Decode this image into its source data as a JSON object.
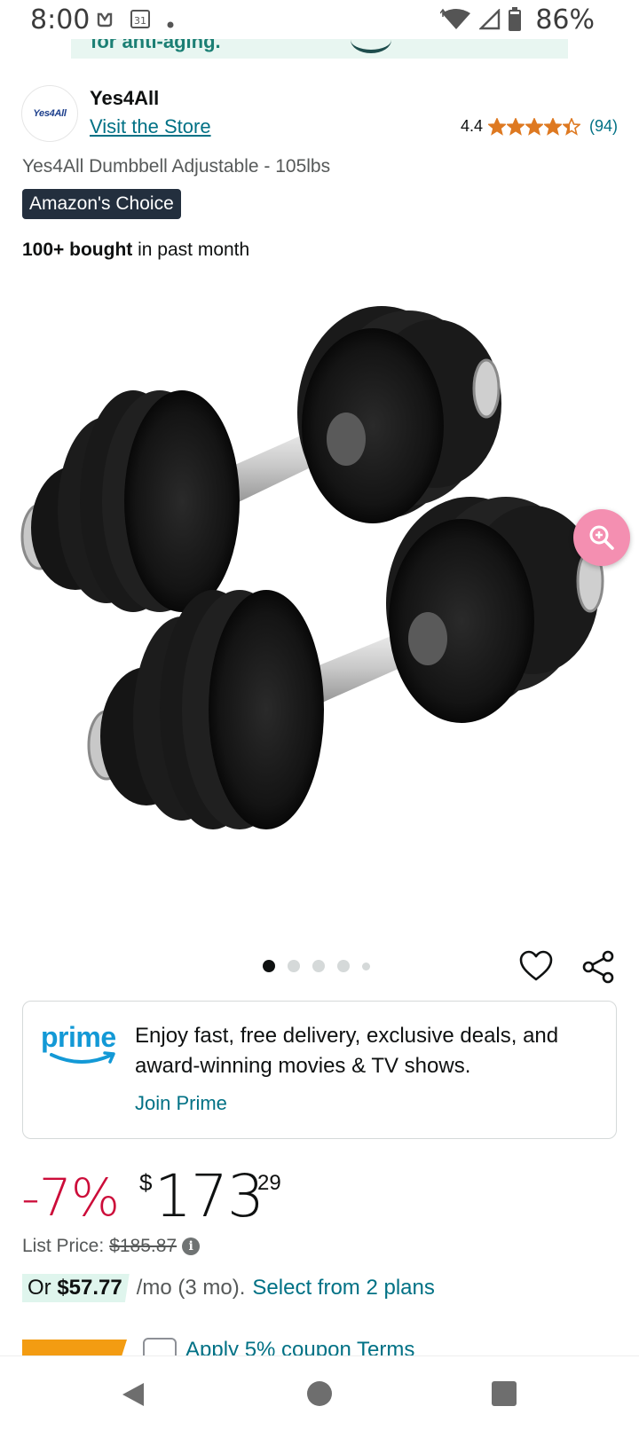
{
  "status_bar": {
    "time": "8:00",
    "calendar_day": "31",
    "battery": "86%"
  },
  "ad": {
    "text": "for anti-aging."
  },
  "seller": {
    "logo_text": "Yes4All",
    "name": "Yes4All",
    "store_link": "Visit the Store",
    "rating_value": "4.4",
    "rating_stars": 4.4,
    "rating_count": "(94)"
  },
  "product": {
    "title": "Yes4All Dumbbell Adjustable - 105lbs",
    "badge": "Amazon's Choice",
    "bought_strong": "100+ bought",
    "bought_rest": " in past month",
    "image_count": 5,
    "active_image": 0
  },
  "prime": {
    "logo": "prime",
    "message": "Enjoy fast, free delivery, exclusive deals, and award-winning movies & TV shows.",
    "join_label": "Join Prime"
  },
  "price": {
    "discount": "-7%",
    "currency": "$",
    "whole": "173",
    "fraction": "29",
    "list_label": "List Price:",
    "list_value": "$185.87"
  },
  "installment": {
    "prefix": "Or ",
    "amount": "$57.77",
    "terms": " /mo (3 mo).",
    "link": "Select from 2 plans"
  },
  "coupon": {
    "text": "Apply 5% coupon  Terms"
  },
  "colors": {
    "link": "#007185",
    "discount": "#cc0c39",
    "badge_bg": "#232f3e",
    "star": "#de7921",
    "zoom_button": "#f48fb1",
    "prime_blue": "#1399d6"
  }
}
